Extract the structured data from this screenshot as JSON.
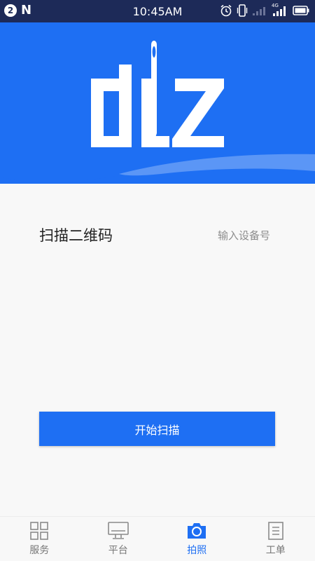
{
  "status_bar": {
    "notification_count": "2",
    "time": "10:45AM",
    "network_label": "4G"
  },
  "header": {
    "logo_icon": "needle-logo-icon",
    "brand_color": "#1e6ff3"
  },
  "scan": {
    "label": "扫描二维码",
    "input_device_link": "输入设备号"
  },
  "start_button": {
    "label": "开始扫描"
  },
  "tabs": [
    {
      "label": "服务",
      "icon": "grid-icon",
      "active": false
    },
    {
      "label": "平台",
      "icon": "monitor-icon",
      "active": false
    },
    {
      "label": "拍照",
      "icon": "camera-icon",
      "active": true
    },
    {
      "label": "工单",
      "icon": "document-icon",
      "active": false
    }
  ]
}
